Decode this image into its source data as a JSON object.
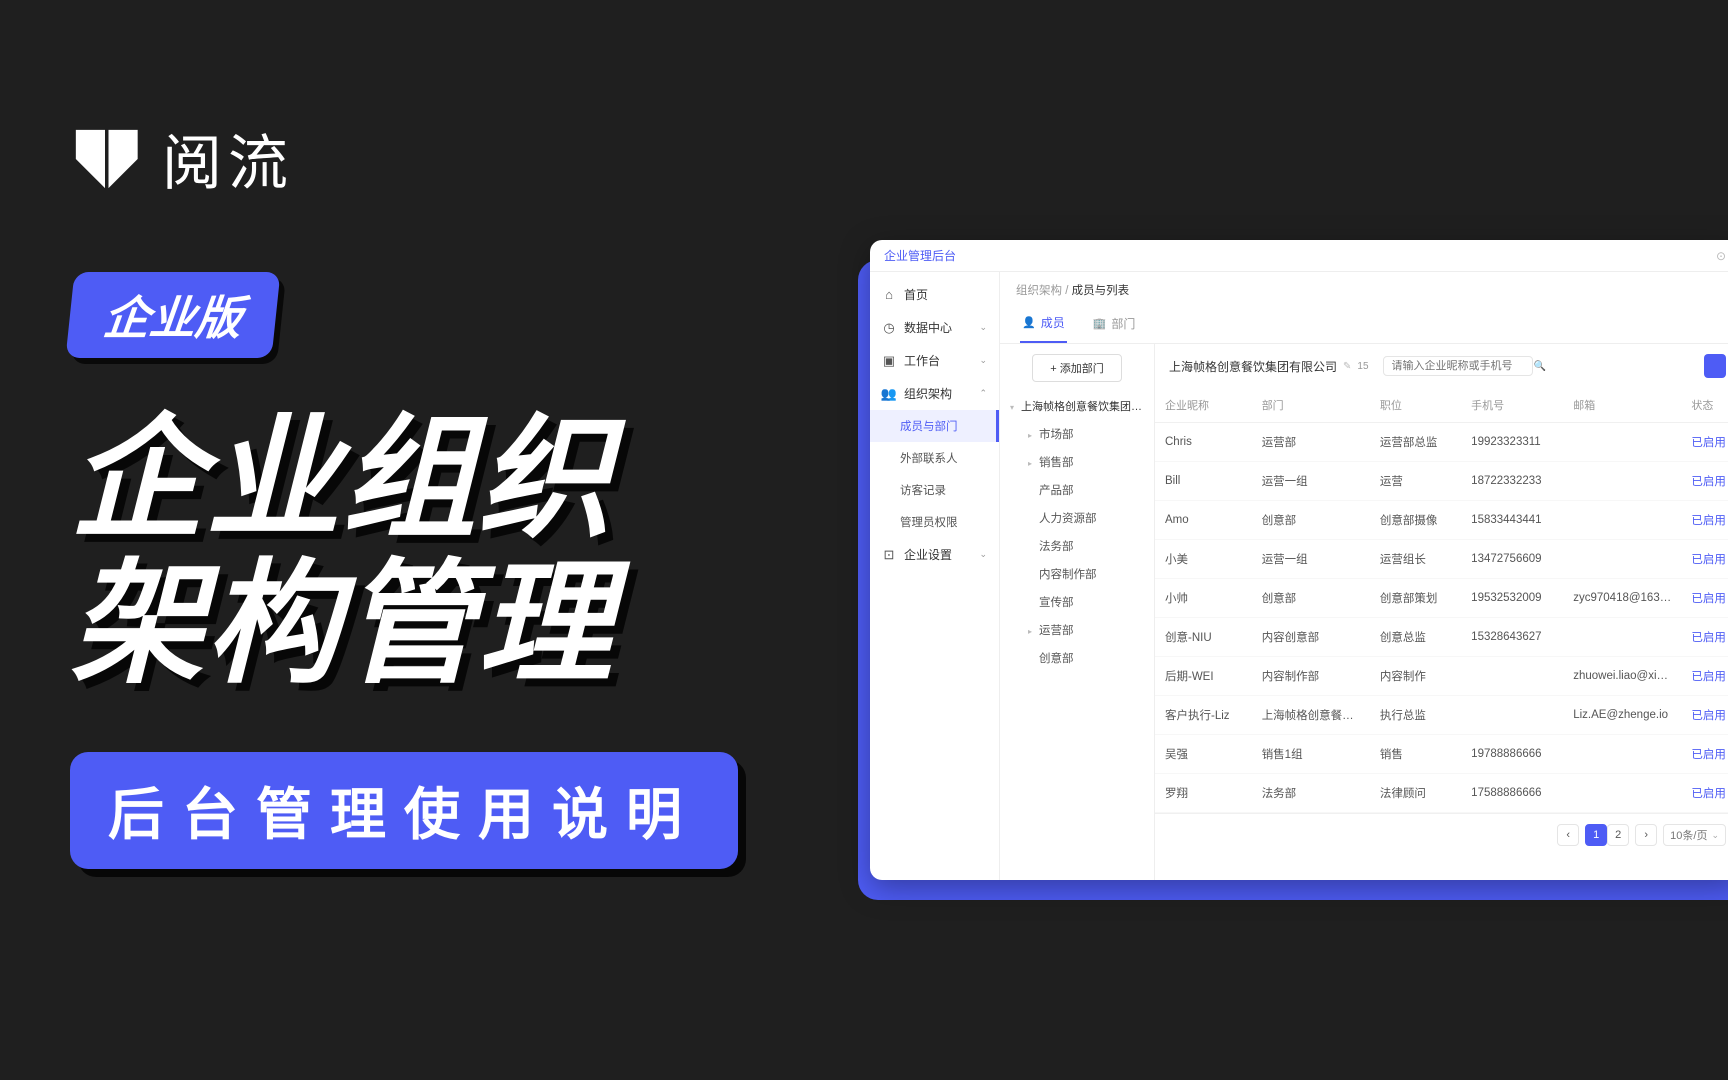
{
  "promo": {
    "logo_text": "阅流",
    "badge": "企业版",
    "slogan": "企业组织\n架构管理",
    "subtitle": "后台管理使用说明"
  },
  "app": {
    "header_title": "企业管理后台",
    "sidebar": {
      "items": [
        {
          "icon": "home",
          "label": "首页",
          "expandable": false
        },
        {
          "icon": "clock",
          "label": "数据中心",
          "expandable": true,
          "expanded": false
        },
        {
          "icon": "grid",
          "label": "工作台",
          "expandable": true,
          "expanded": false
        },
        {
          "icon": "org",
          "label": "组织架构",
          "expandable": true,
          "expanded": true,
          "children": [
            {
              "label": "成员与部门",
              "active": true
            },
            {
              "label": "外部联系人",
              "active": false
            },
            {
              "label": "访客记录",
              "active": false
            },
            {
              "label": "管理员权限",
              "active": false
            }
          ]
        },
        {
          "icon": "gear",
          "label": "企业设置",
          "expandable": true,
          "expanded": false
        }
      ]
    },
    "breadcrumb": {
      "a": "组织架构",
      "b": "成员与列表"
    },
    "tabs": [
      {
        "icon": "user",
        "label": "成员",
        "active": true
      },
      {
        "icon": "dept",
        "label": "部门",
        "active": false
      }
    ],
    "dept_tree": {
      "add_button": "+ 添加部门",
      "root": "上海帧格创意餐饮集团有限公司",
      "nodes": [
        {
          "label": "市场部",
          "has_children": true
        },
        {
          "label": "销售部",
          "has_children": true
        },
        {
          "label": "产品部",
          "has_children": false
        },
        {
          "label": "人力资源部",
          "has_children": false
        },
        {
          "label": "法务部",
          "has_children": false
        },
        {
          "label": "内容制作部",
          "has_children": false
        },
        {
          "label": "宣传部",
          "has_children": false
        },
        {
          "label": "运营部",
          "has_children": true
        },
        {
          "label": "创意部",
          "has_children": false
        }
      ]
    },
    "table_header": {
      "org_name": "上海帧格创意餐饮集团有限公司",
      "member_count": "15",
      "search_placeholder": "请输入企业昵称或手机号"
    },
    "columns": [
      "企业昵称",
      "部门",
      "职位",
      "手机号",
      "邮箱",
      "状态"
    ],
    "rows": [
      {
        "name": "Chris",
        "dept": "运营部",
        "role": "运营部总监",
        "phone": "19923323311",
        "email": "",
        "status": "已启用"
      },
      {
        "name": "Bill",
        "dept": "运营一组",
        "role": "运营",
        "phone": "18722332233",
        "email": "",
        "status": "已启用"
      },
      {
        "name": "Amo",
        "dept": "创意部",
        "role": "创意部摄像",
        "phone": "15833443441",
        "email": "",
        "status": "已启用"
      },
      {
        "name": "小美",
        "dept": "运营一组",
        "role": "运营组长",
        "phone": "13472756609",
        "email": "",
        "status": "已启用"
      },
      {
        "name": "小帅",
        "dept": "创意部",
        "role": "创意部策划",
        "phone": "19532532009",
        "email": "zyc970418@163…",
        "status": "已启用"
      },
      {
        "name": "创意-NIU",
        "dept": "内容创意部",
        "role": "创意总监",
        "phone": "15328643627",
        "email": "",
        "status": "已启用"
      },
      {
        "name": "后期-WEI",
        "dept": "内容制作部",
        "role": "内容制作",
        "phone": "",
        "email": "zhuowei.liao@xi…",
        "status": "已启用"
      },
      {
        "name": "客户执行-Liz",
        "dept": "上海帧格创意餐…",
        "role": "执行总监",
        "phone": "",
        "email": "Liz.AE@zhenge.io",
        "status": "已启用"
      },
      {
        "name": "吴强",
        "dept": "销售1组",
        "role": "销售",
        "phone": "19788886666",
        "email": "",
        "status": "已启用"
      },
      {
        "name": "罗翔",
        "dept": "法务部",
        "role": "法律顾问",
        "phone": "17588886666",
        "email": "",
        "status": "已启用"
      }
    ],
    "pagination": {
      "current": "1",
      "pages": [
        "1",
        "2"
      ],
      "page_size_label": "10条/页"
    }
  },
  "icons": {
    "home": "⌂",
    "clock": "◷",
    "grid": "▣",
    "org": "⛪",
    "gear": "⚙",
    "user": "👤",
    "dept": "🏢",
    "search": "🔍",
    "chev_down": "⌄",
    "chev_up": "⌃",
    "chev_left": "‹",
    "chev_right": "›",
    "caret": "▸",
    "edit": "✎"
  }
}
